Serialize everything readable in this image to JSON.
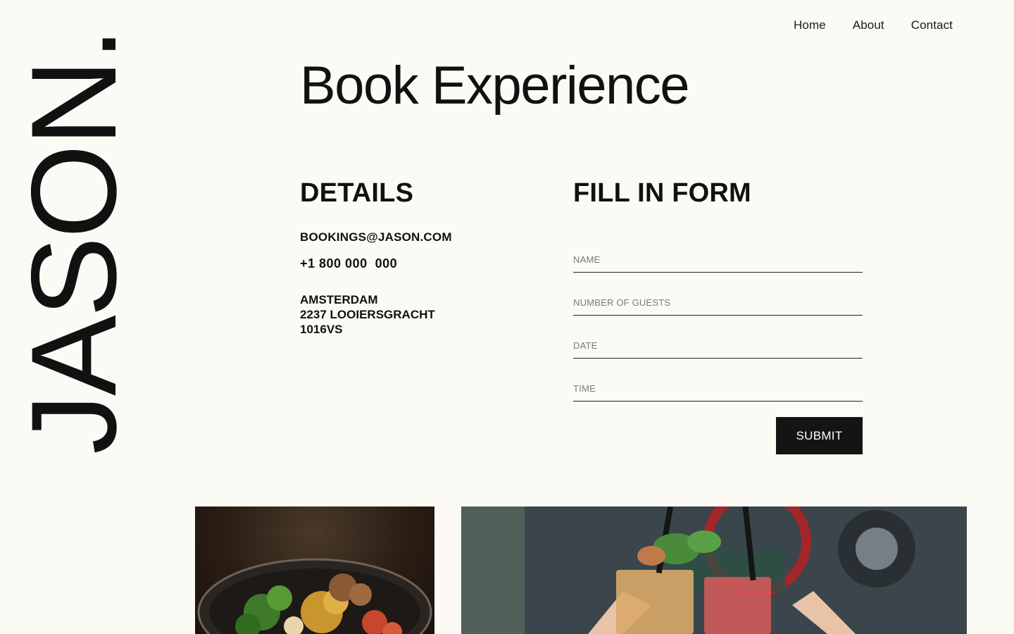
{
  "nav": {
    "items": [
      {
        "label": "Home"
      },
      {
        "label": "About"
      },
      {
        "label": "Contact"
      }
    ]
  },
  "brand": {
    "logo_text": "JASON."
  },
  "page": {
    "title": "Book Experience"
  },
  "details": {
    "heading": "DETAILS",
    "email": "BOOKINGS@JASON.COM",
    "phone": "+1 800 000  000",
    "address_line1": "AMSTERDAM",
    "address_line2": "2237 LOOIERSGRACHT",
    "address_line3": "1016VS"
  },
  "form": {
    "heading": "FILL IN FORM",
    "fields": {
      "name": {
        "placeholder": "NAME",
        "value": ""
      },
      "guests": {
        "placeholder": "NUMBER OF GUESTS",
        "value": ""
      },
      "date": {
        "placeholder": "DATE",
        "value": ""
      },
      "time": {
        "placeholder": "TIME",
        "value": ""
      }
    },
    "submit_label": "SUBMIT"
  },
  "colors": {
    "background": "#fcfaf5",
    "text": "#111111",
    "button": "#141414"
  }
}
